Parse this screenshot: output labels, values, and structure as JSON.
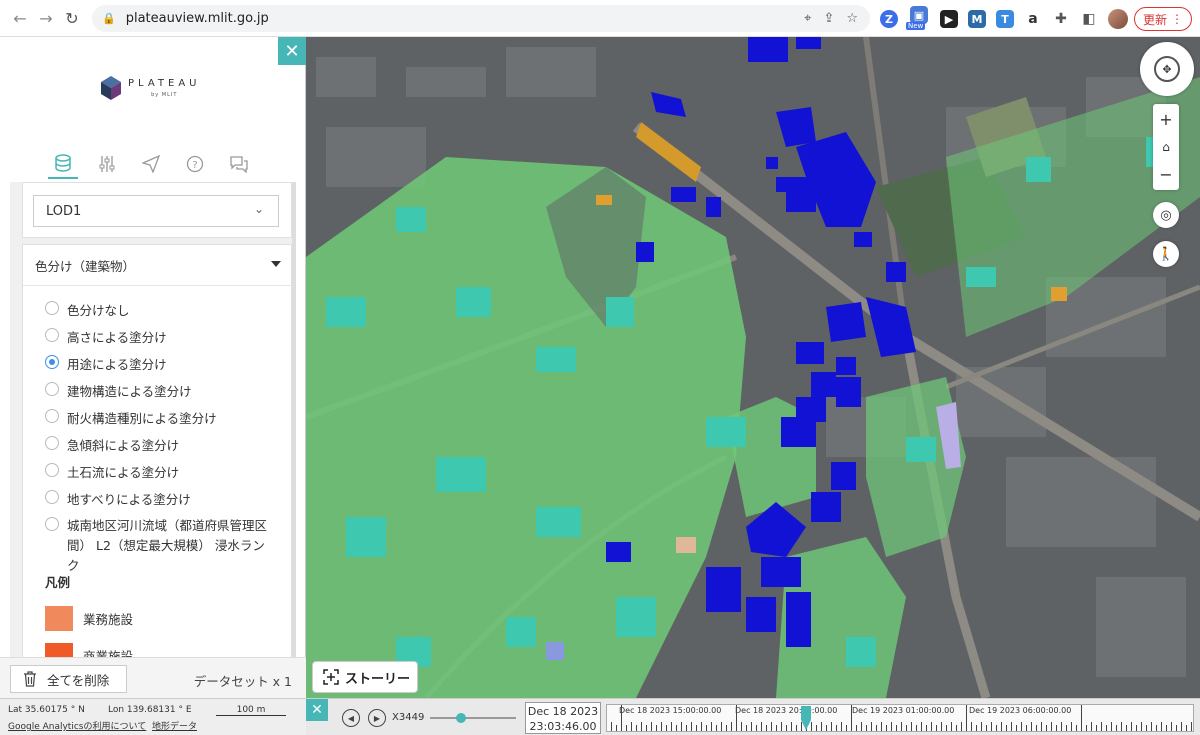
{
  "browser": {
    "url": "plateauview.mlit.go.jp",
    "update_label": "更新",
    "ext_new_label": "New"
  },
  "sidebar": {
    "logo_text": "PLATEAU",
    "logo_sub": "by MLIT",
    "lod_select": "LOD1",
    "color_section_title": "色分け（建築物）",
    "color_options": [
      "色分けなし",
      "高さによる塗分け",
      "用途による塗分け",
      "建物構造による塗分け",
      "耐火構造種別による塗分け",
      "急傾斜による塗分け",
      "土石流による塗分け",
      "地すべりによる塗分け",
      "城南地区河川流域（都道府県管理区間） L2（想定最大規模） 浸水ランク"
    ],
    "selected_option_index": 2,
    "legend_title": "凡例",
    "legend_items": [
      {
        "label": "業務施設",
        "color": "#f08a5d"
      },
      {
        "label": "商業施設",
        "color": "#f05a28"
      }
    ],
    "delete_all_label": "全てを削除",
    "dataset_count": "データセット x 1"
  },
  "map": {
    "story_label": "ストーリー"
  },
  "status": {
    "lat": "Lat 35.60175 ° N",
    "lon": "Lon 139.68131 ° E",
    "scale": "100 m",
    "ga_link": "Google Analyticsの利用について",
    "terrain_link": "地形データ"
  },
  "timeline": {
    "speed": "X3449",
    "current_date": "Dec 18 2023",
    "current_time": "23:03:46.00",
    "labels": [
      "Dec 18 2023 15:00:00.00",
      "Dec 18 2023 20:00:00.00",
      "Dec 19 2023 01:00:00.00",
      "Dec 19 2023 06:00:00.00"
    ]
  },
  "colors": {
    "accent": "#46b6b6",
    "radio_selected": "#3f8ee6",
    "residential": "#7fd17a",
    "teal": "#40c9b0",
    "public": "#1010d0",
    "commercial_orange": "#e0a030"
  }
}
